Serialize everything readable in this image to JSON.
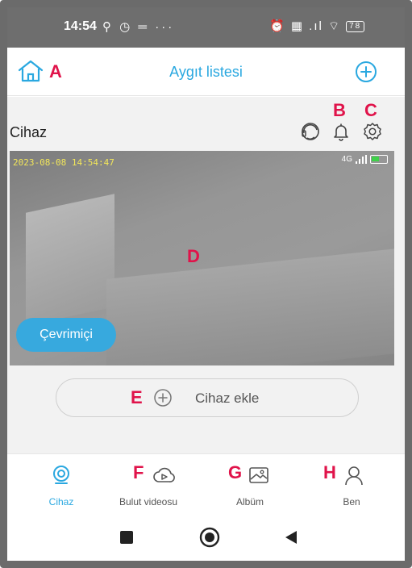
{
  "status_bar": {
    "time": "14:54",
    "left_icons": "⚲ ◷ ═ ···",
    "right_icons": "⏰ ▦ .ıl ⌔",
    "battery": "78"
  },
  "header": {
    "title": "Aygıt listesi"
  },
  "annotations": {
    "a": "A",
    "b": "B",
    "c": "C",
    "d": "D",
    "e": "E",
    "f": "F",
    "g": "G",
    "h": "H"
  },
  "device": {
    "name": "Cihaz",
    "timestamp": "2023-08-08 14:54:47",
    "network": "4G",
    "status": "Çevrimiçi"
  },
  "add_device": {
    "label": "Cihaz ekle"
  },
  "bottom_nav": {
    "items": [
      {
        "label": "Cihaz",
        "icon": "camera-device-icon",
        "active": true
      },
      {
        "label": "Bulut videosu",
        "icon": "cloud-video-icon",
        "active": false
      },
      {
        "label": "Albüm",
        "icon": "album-icon",
        "active": false
      },
      {
        "label": "Ben",
        "icon": "profile-icon",
        "active": false
      }
    ]
  },
  "colors": {
    "accent": "#2aa8e0",
    "annotation": "#e0134a",
    "status_bar": "#6e6e6e"
  }
}
